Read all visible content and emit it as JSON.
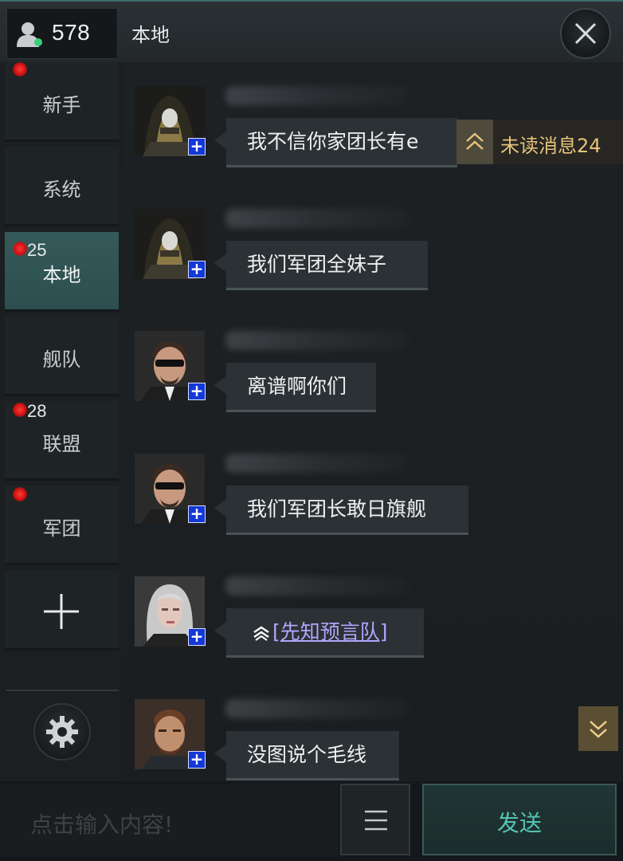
{
  "header": {
    "online_count": "578",
    "channel_title": "本地"
  },
  "sidebar": {
    "tabs": [
      {
        "label": "新手",
        "unread_dot": true,
        "count": ""
      },
      {
        "label": "系统",
        "unread_dot": false,
        "count": ""
      },
      {
        "label": "本地",
        "unread_dot": true,
        "count": "25",
        "active": true
      },
      {
        "label": "舰队",
        "unread_dot": false,
        "count": ""
      },
      {
        "label": "联盟",
        "unread_dot": true,
        "count": "28"
      },
      {
        "label": "军团",
        "unread_dot": true,
        "count": ""
      }
    ]
  },
  "messages": [
    {
      "avatar": "hooded-pilot",
      "text": "我不信你家团长有e"
    },
    {
      "avatar": "hooded-pilot",
      "text": "我们军团全妹子"
    },
    {
      "avatar": "sunglasses-man",
      "text": "离谱啊你们"
    },
    {
      "avatar": "sunglasses-man",
      "text": "我们军团长敢日旗舰"
    },
    {
      "avatar": "silver-hair-woman",
      "text": "[先知预言队]"
    },
    {
      "avatar": "bearded-man",
      "text": "没图说个毛线"
    }
  ],
  "unread": {
    "label": "未读消息24"
  },
  "input": {
    "placeholder": "点击输入内容!",
    "send_label": "发送"
  },
  "colors": {
    "accent_teal": "#55c3b5",
    "unread_gold": "#e6c27a",
    "badge_red": "#e01818",
    "link_purple": "#b3a4ff"
  }
}
